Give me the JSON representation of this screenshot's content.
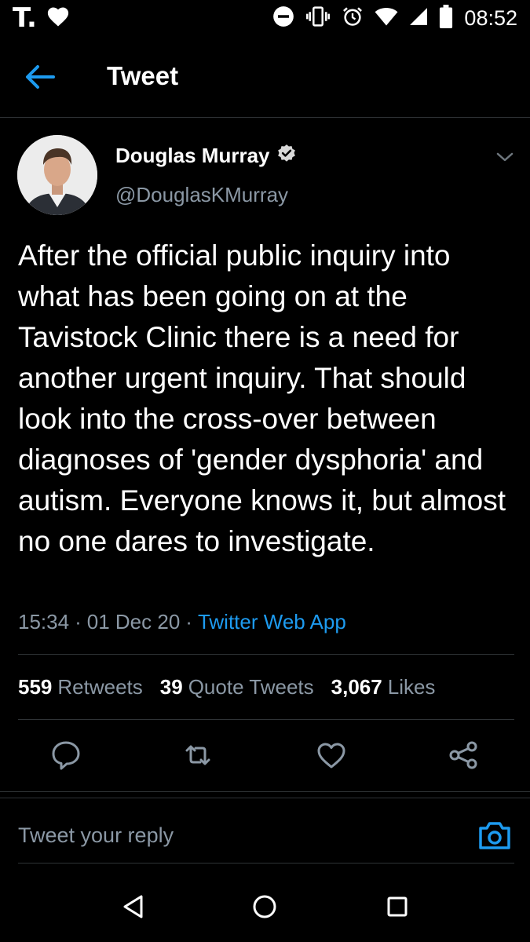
{
  "status_bar": {
    "carrier_logo": "T.",
    "time": "08:52",
    "icons": [
      "heart-icon",
      "do-not-disturb-icon",
      "vibrate-icon",
      "alarm-icon",
      "wifi-icon",
      "cell-signal-icon",
      "battery-icon"
    ]
  },
  "app_bar": {
    "title": "Tweet",
    "back_icon": "arrow-left-icon"
  },
  "tweet": {
    "author_name": "Douglas Murray",
    "author_handle": "@DouglasKMurray",
    "verified": true,
    "text": "After the official public inquiry into what has been going on at the Tavistock Clinic there is a need for another urgent inquiry. That should look into the cross-over between diagnoses of 'gender dysphoria' and autism. Everyone knows it, but almost no one dares to investigate.",
    "time": "15:34",
    "separator": "·",
    "date": "01 Dec 20",
    "source": "Twitter Web App"
  },
  "stats": {
    "retweets_count": "559",
    "retweets_label": "Retweets",
    "quotes_count": "39",
    "quotes_label": "Quote Tweets",
    "likes_count": "3,067",
    "likes_label": "Likes"
  },
  "actions": [
    "reply-icon",
    "retweet-icon",
    "like-icon",
    "share-icon"
  ],
  "reply": {
    "placeholder": "Tweet your reply"
  },
  "colors": {
    "background": "#000000",
    "accent": "#1d9bf0",
    "secondary_text": "#8b98a5",
    "divider": "#2f3336"
  }
}
